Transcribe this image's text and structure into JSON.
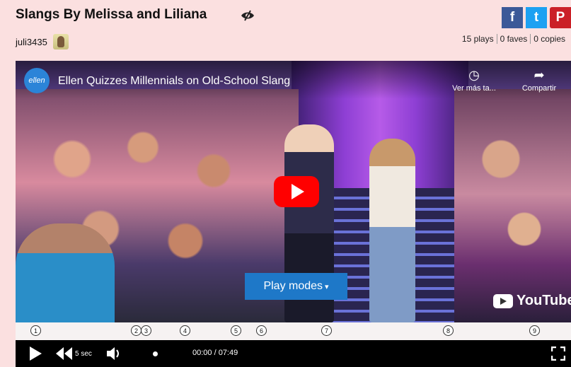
{
  "header": {
    "title": "Slangs By Melissa and Liliana",
    "username": "juli3435",
    "social": [
      "f",
      "t",
      "P"
    ],
    "stats": [
      "15 plays",
      "0 faves",
      "0 copies"
    ]
  },
  "video": {
    "channel_logo_text": "ellen",
    "title": "Ellen Quizzes Millennials on Old-School Slang",
    "watch_later": "Ver más ta...",
    "share": "Compartir",
    "play_modes": "Play modes",
    "youtube": "YouTube"
  },
  "timeline": {
    "markers": [
      "1",
      "2",
      "3",
      "4",
      "5",
      "6",
      "7",
      "8",
      "9"
    ]
  },
  "controls": {
    "skip_label": "5 sec",
    "time": "00:00 / 07:49"
  },
  "colors": {
    "background": "#fbe0e0",
    "play_modes": "#1e78c8",
    "youtube_red": "#ff0000"
  }
}
